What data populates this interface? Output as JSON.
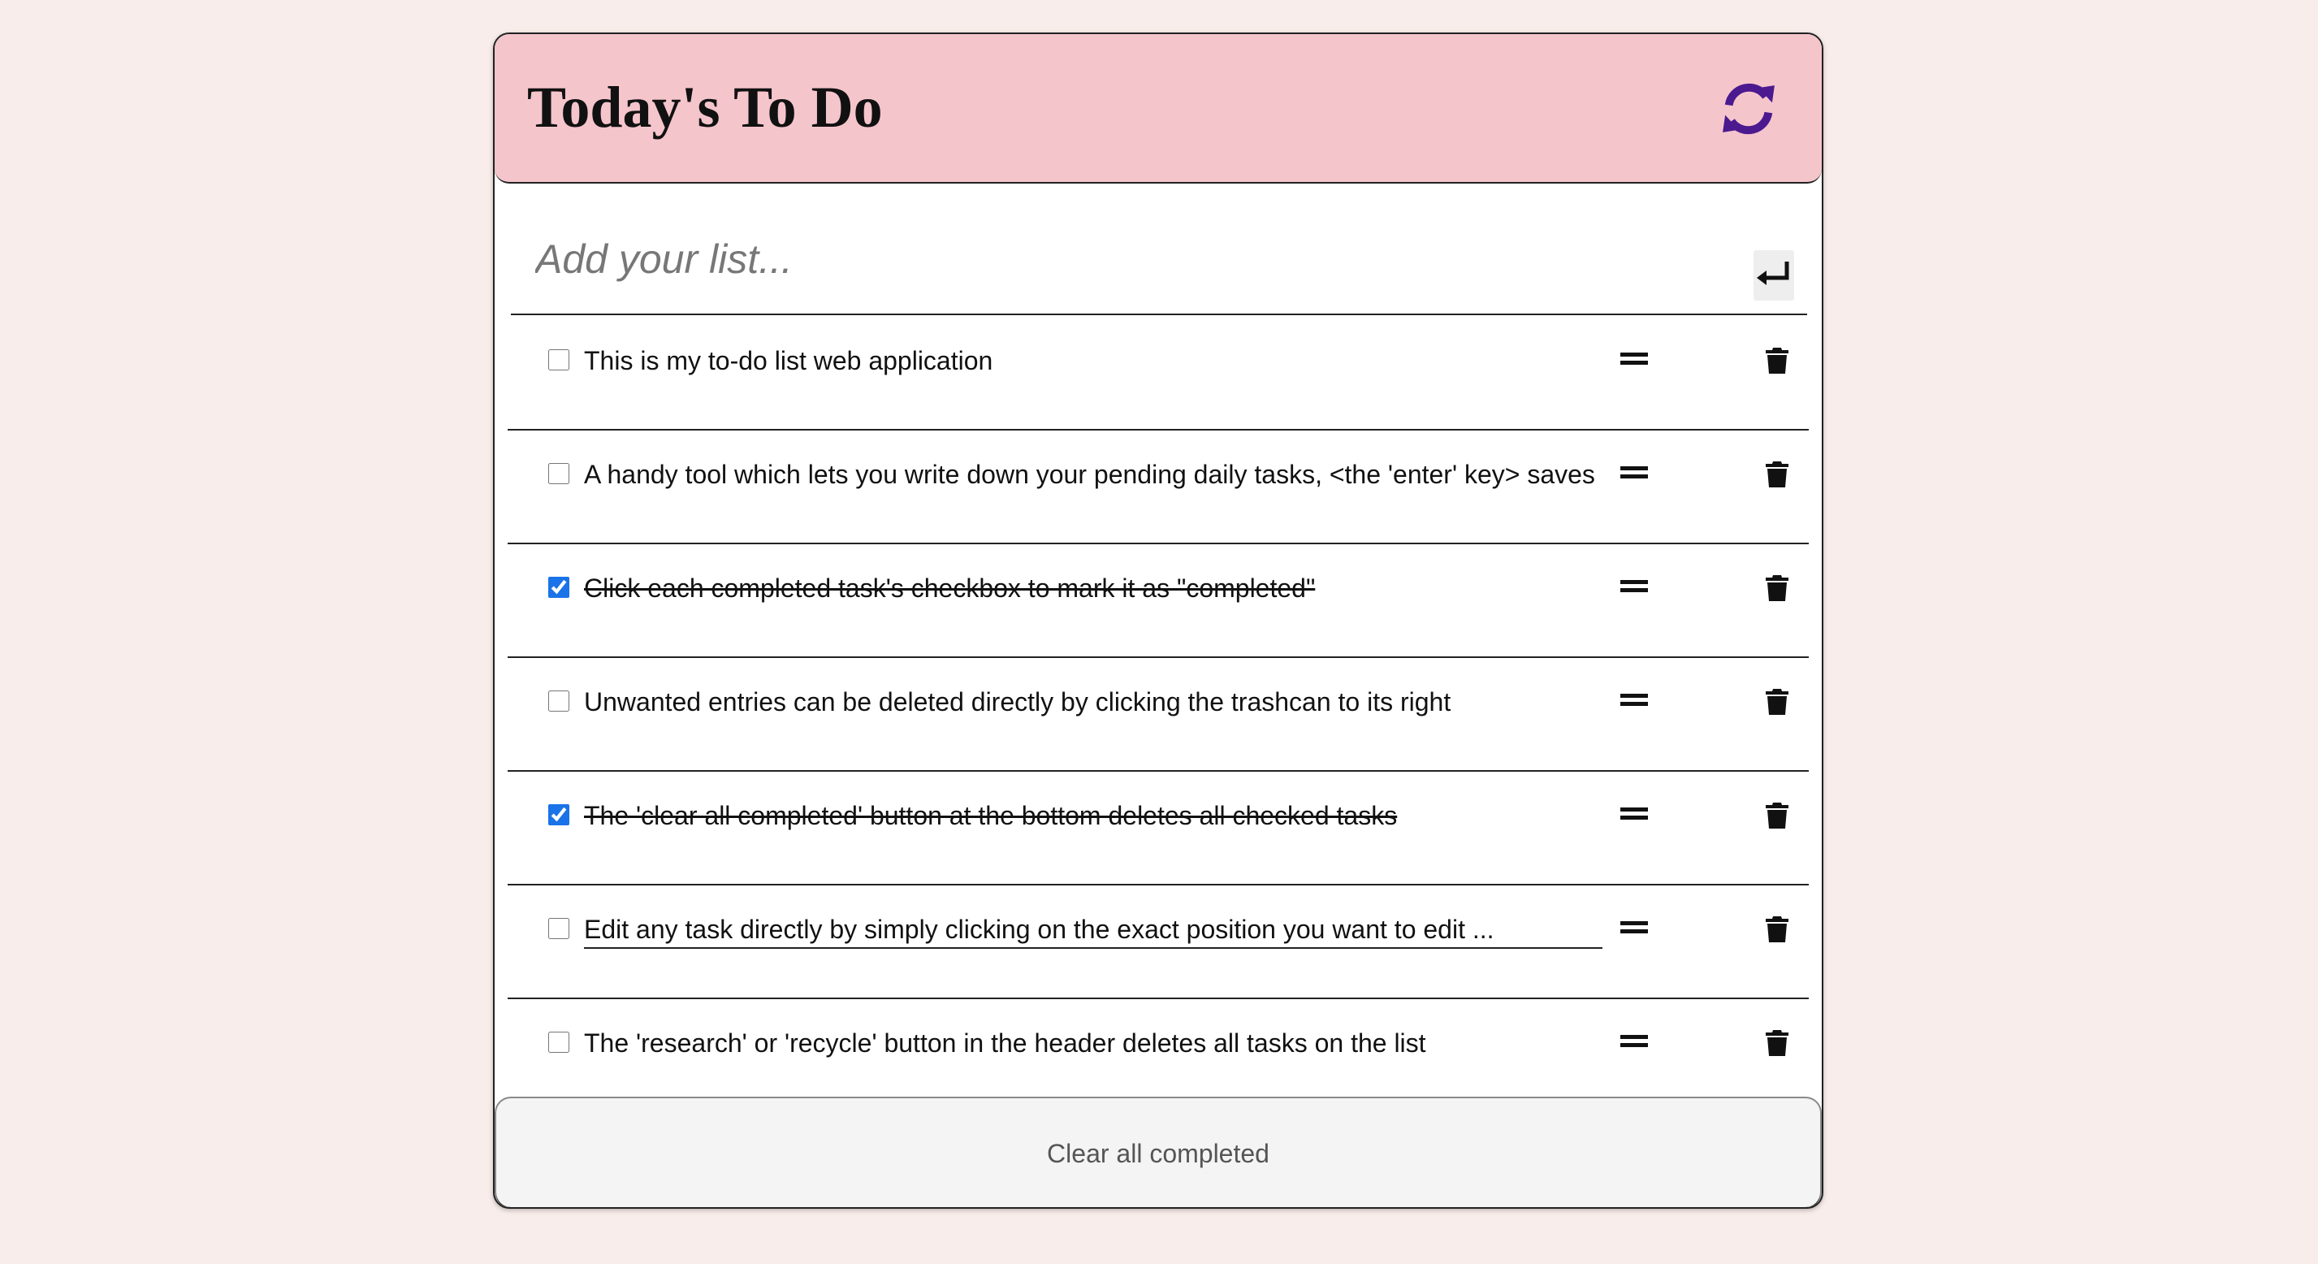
{
  "header": {
    "title": "Today's To Do",
    "refresh_icon": "refresh-icon",
    "refresh_color": "#4b1a8f",
    "background": "#f5c5cc"
  },
  "add_task": {
    "placeholder": "Add your list...",
    "value": "",
    "enter_icon": "enter-key-icon"
  },
  "tasks": [
    {
      "text": "This is my to-do list web application",
      "completed": false
    },
    {
      "text": "A handy tool which lets you write down your pending daily tasks, <the 'enter' key> saves",
      "completed": false
    },
    {
      "text": "Click each completed task's checkbox to mark it as \"completed\"",
      "completed": true
    },
    {
      "text": "Unwanted entries can be deleted directly by clicking the trashcan to its right",
      "completed": false
    },
    {
      "text": "The 'clear all completed' button at the bottom deletes all checked tasks",
      "completed": true
    },
    {
      "text": "Edit any task directly by simply clicking on the exact position you want to edit ...",
      "completed": false,
      "editing": true
    },
    {
      "text": "The 'research' or 'recycle' button in the header deletes all tasks on the list",
      "completed": false
    }
  ],
  "icons": {
    "drag": "drag-handle-icon",
    "delete": "trash-icon"
  },
  "footer": {
    "clear_label": "Clear all completed"
  },
  "colors": {
    "page_background": "#f8edea",
    "checkbox_accent": "#1a73e8"
  }
}
